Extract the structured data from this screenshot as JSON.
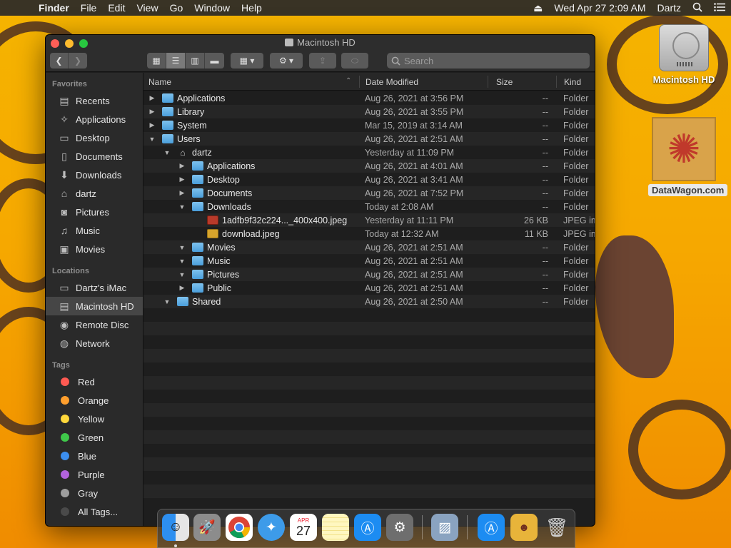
{
  "menubar": {
    "apple": "",
    "items": [
      "Finder",
      "File",
      "Edit",
      "View",
      "Go",
      "Window",
      "Help"
    ],
    "eject": "⏏",
    "datetime": "Wed Apr 27  2:09 AM",
    "user": "Dartz"
  },
  "desktop": {
    "hd_label": "Macintosh HD",
    "image_label": "DataWagon.com"
  },
  "window": {
    "title": "Macintosh HD",
    "search_placeholder": "Search"
  },
  "sidebar": {
    "favorites_header": "Favorites",
    "favorites": [
      "Recents",
      "Applications",
      "Desktop",
      "Documents",
      "Downloads",
      "dartz",
      "Pictures",
      "Music",
      "Movies"
    ],
    "locations_header": "Locations",
    "locations": [
      "Dartz's iMac",
      "Macintosh HD",
      "Remote Disc",
      "Network"
    ],
    "tags_header": "Tags",
    "tags": [
      {
        "label": "Red",
        "color": "#ff5a52"
      },
      {
        "label": "Orange",
        "color": "#ff9f2d"
      },
      {
        "label": "Yellow",
        "color": "#ffd83b"
      },
      {
        "label": "Green",
        "color": "#3fc84a"
      },
      {
        "label": "Blue",
        "color": "#3c8fef"
      },
      {
        "label": "Purple",
        "color": "#b263dd"
      },
      {
        "label": "Gray",
        "color": "#9e9e9e"
      },
      {
        "label": "All Tags...",
        "color": "#4a4a4a"
      }
    ]
  },
  "columns": {
    "name": "Name",
    "date": "Date Modified",
    "size": "Size",
    "kind": "Kind"
  },
  "rows": [
    {
      "name": "Applications",
      "date": "Aug 26, 2021 at 3:56 PM",
      "size": "--",
      "kind": "Folder"
    },
    {
      "name": "Library",
      "date": "Aug 26, 2021 at 3:55 PM",
      "size": "--",
      "kind": "Folder"
    },
    {
      "name": "System",
      "date": "Mar 15, 2019 at 3:14 AM",
      "size": "--",
      "kind": "Folder"
    },
    {
      "name": "Users",
      "date": "Aug 26, 2021 at 2:51 AM",
      "size": "--",
      "kind": "Folder"
    },
    {
      "name": "dartz",
      "date": "Yesterday at 11:09 PM",
      "size": "--",
      "kind": "Folder"
    },
    {
      "name": "Applications",
      "date": "Aug 26, 2021 at 4:01 AM",
      "size": "--",
      "kind": "Folder"
    },
    {
      "name": "Desktop",
      "date": "Aug 26, 2021 at 3:41 AM",
      "size": "--",
      "kind": "Folder"
    },
    {
      "name": "Documents",
      "date": "Aug 26, 2021 at 7:52 PM",
      "size": "--",
      "kind": "Folder"
    },
    {
      "name": "Downloads",
      "date": "Today at 2:08 AM",
      "size": "--",
      "kind": "Folder"
    },
    {
      "name": "1adfb9f32c224..._400x400.jpeg",
      "date": "Yesterday at 11:11 PM",
      "size": "26 KB",
      "kind": "JPEG im"
    },
    {
      "name": "download.jpeg",
      "date": "Today at 12:32 AM",
      "size": "11 KB",
      "kind": "JPEG im"
    },
    {
      "name": "Movies",
      "date": "Aug 26, 2021 at 2:51 AM",
      "size": "--",
      "kind": "Folder"
    },
    {
      "name": "Music",
      "date": "Aug 26, 2021 at 2:51 AM",
      "size": "--",
      "kind": "Folder"
    },
    {
      "name": "Pictures",
      "date": "Aug 26, 2021 at 2:51 AM",
      "size": "--",
      "kind": "Folder"
    },
    {
      "name": "Public",
      "date": "Aug 26, 2021 at 2:51 AM",
      "size": "--",
      "kind": "Folder"
    },
    {
      "name": "Shared",
      "date": "Aug 26, 2021 at 2:50 AM",
      "size": "--",
      "kind": "Folder"
    }
  ],
  "dock": {
    "calendar_month": "APR",
    "calendar_day": "27"
  }
}
